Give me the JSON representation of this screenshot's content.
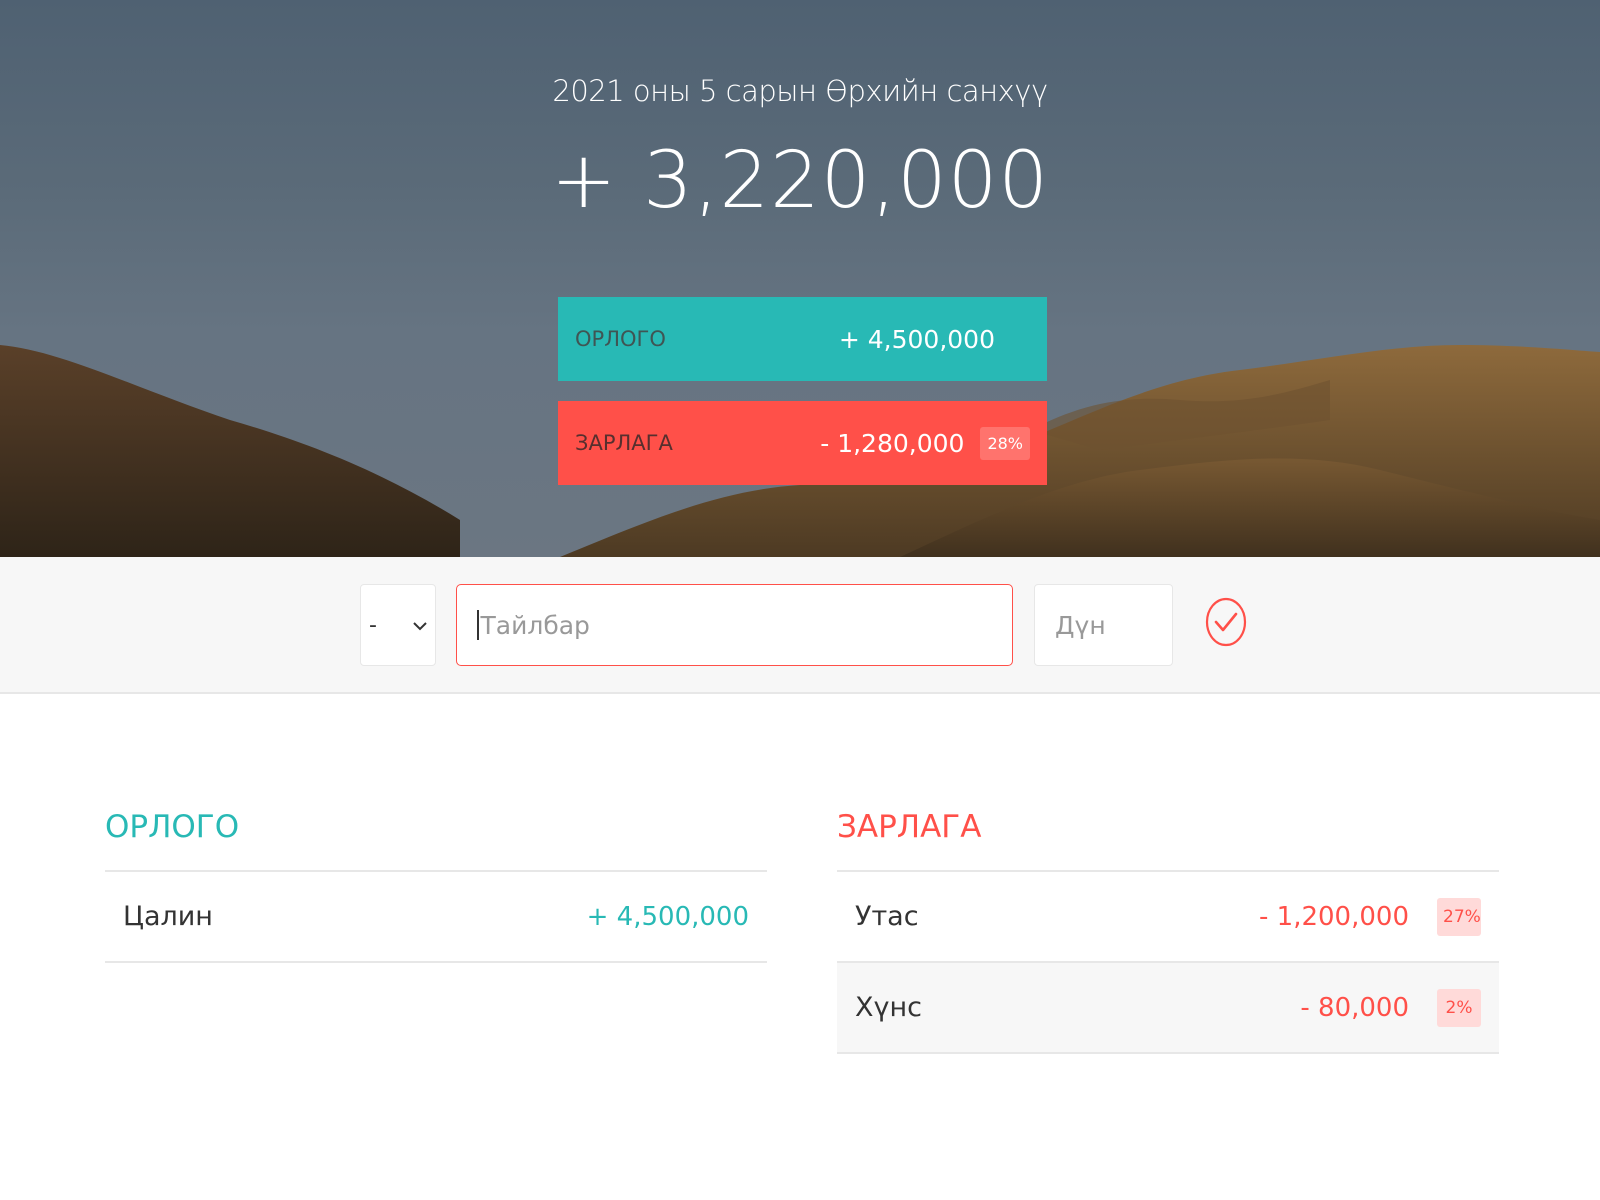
{
  "header": {
    "title": "2021 оны 5 сарын Өрхийн санхүү",
    "budget_value": "+ 3,220,000",
    "income": {
      "label": "ОРЛОГО",
      "value": "+ 4,500,000",
      "percent": ""
    },
    "expense": {
      "label": "ЗАРЛАГА",
      "value": "- 1,280,000",
      "percent": "28%"
    }
  },
  "add_form": {
    "type_selected": "-",
    "description_placeholder": "Тайлбар",
    "value_placeholder": "Дүн",
    "submit_icon": "checkmark-circle-icon",
    "accent_color": "#ff5049"
  },
  "income_list": {
    "title": "ОРЛОГО",
    "items": [
      {
        "description": "Цалин",
        "value": "+ 4,500,000"
      }
    ]
  },
  "expense_list": {
    "title": "ЗАРЛАГА",
    "items": [
      {
        "description": "Утас",
        "value": "- 1,200,000",
        "percent": "27%"
      },
      {
        "description": "Хүнс",
        "value": "- 80,000",
        "percent": "2%"
      }
    ]
  },
  "colors": {
    "income": "#28b9b5",
    "expense": "#ff5049"
  }
}
